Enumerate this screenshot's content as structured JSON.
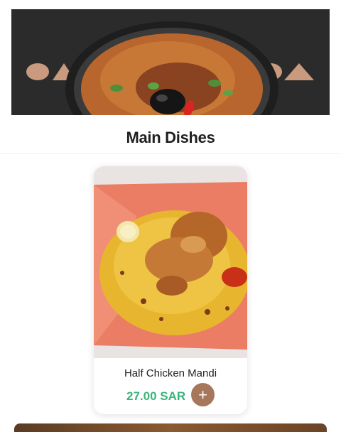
{
  "section": {
    "title": "Main Dishes"
  },
  "hero": {
    "image": "mandi-rice-platter-banner"
  },
  "menu_items": [
    {
      "name": "Half Chicken Mandi",
      "price": "27.00 SAR",
      "add_label": "+",
      "image": "half-chicken-mandi-photo"
    }
  ],
  "colors": {
    "price": "#3bb37a",
    "add_button": "#a7775c",
    "banner_background": "#2b2b2b"
  }
}
